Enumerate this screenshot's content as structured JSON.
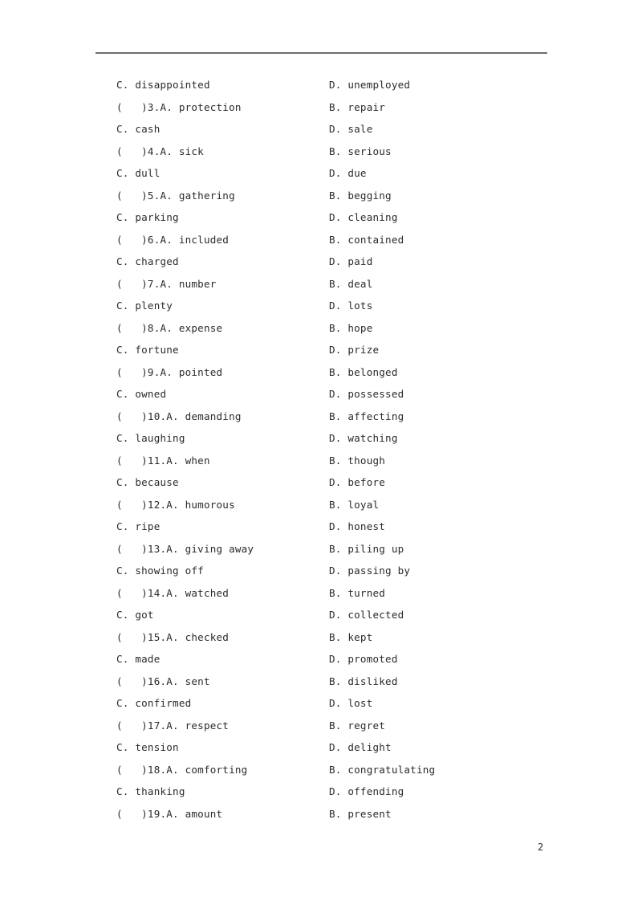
{
  "document": {
    "page_number": "2",
    "rule_color": "#6e6e6e",
    "text_color": "#2b2b2b",
    "background_color": "#ffffff"
  },
  "lines": [
    {
      "left": "C. disappointed",
      "right": "D. unemployed"
    },
    {
      "left": "(   )3.A. protection",
      "right": "B. repair"
    },
    {
      "left": "C. cash",
      "right": "D. sale"
    },
    {
      "left": "(   )4.A. sick",
      "right": "B. serious"
    },
    {
      "left": "C. dull",
      "right": "D. due"
    },
    {
      "left": "(   )5.A. gathering",
      "right": "B. begging"
    },
    {
      "left": "C. parking",
      "right": "D. cleaning"
    },
    {
      "left": "(   )6.A. included",
      "right": "B. contained"
    },
    {
      "left": "C. charged",
      "right": "D. paid"
    },
    {
      "left": "(   )7.A. number",
      "right": "B. deal"
    },
    {
      "left": "C. plenty",
      "right": "D. lots"
    },
    {
      "left": "(   )8.A. expense",
      "right": "B. hope"
    },
    {
      "left": "C. fortune",
      "right": "D. prize"
    },
    {
      "left": "(   )9.A. pointed",
      "right": "B. belonged"
    },
    {
      "left": "C. owned",
      "right": "D. possessed"
    },
    {
      "left": "(   )10.A. demanding",
      "right": "B. affecting"
    },
    {
      "left": "C. laughing",
      "right": "D. watching"
    },
    {
      "left": "(   )11.A. when",
      "right": "B. though"
    },
    {
      "left": "C. because",
      "right": "D. before"
    },
    {
      "left": "(   )12.A. humorous",
      "right": "B. loyal"
    },
    {
      "left": "C. ripe",
      "right": "D. honest"
    },
    {
      "left": "(   )13.A. giving away",
      "right": "B. piling up"
    },
    {
      "left": "C. showing off",
      "right": "D. passing by"
    },
    {
      "left": "(   )14.A. watched",
      "right": "B. turned"
    },
    {
      "left": "C. got",
      "right": "D. collected"
    },
    {
      "left": "(   )15.A. checked",
      "right": "B. kept"
    },
    {
      "left": "C. made",
      "right": "D. promoted"
    },
    {
      "left": "(   )16.A. sent",
      "right": "B. disliked"
    },
    {
      "left": "C. confirmed",
      "right": "D. lost"
    },
    {
      "left": "(   )17.A. respect",
      "right": "B. regret"
    },
    {
      "left": "C. tension",
      "right": "D. delight"
    },
    {
      "left": "(   )18.A. comforting",
      "right": "B. congratulating"
    },
    {
      "left": "C. thanking",
      "right": "D. offending"
    },
    {
      "left": "(   )19.A. amount",
      "right": "B. present"
    }
  ]
}
